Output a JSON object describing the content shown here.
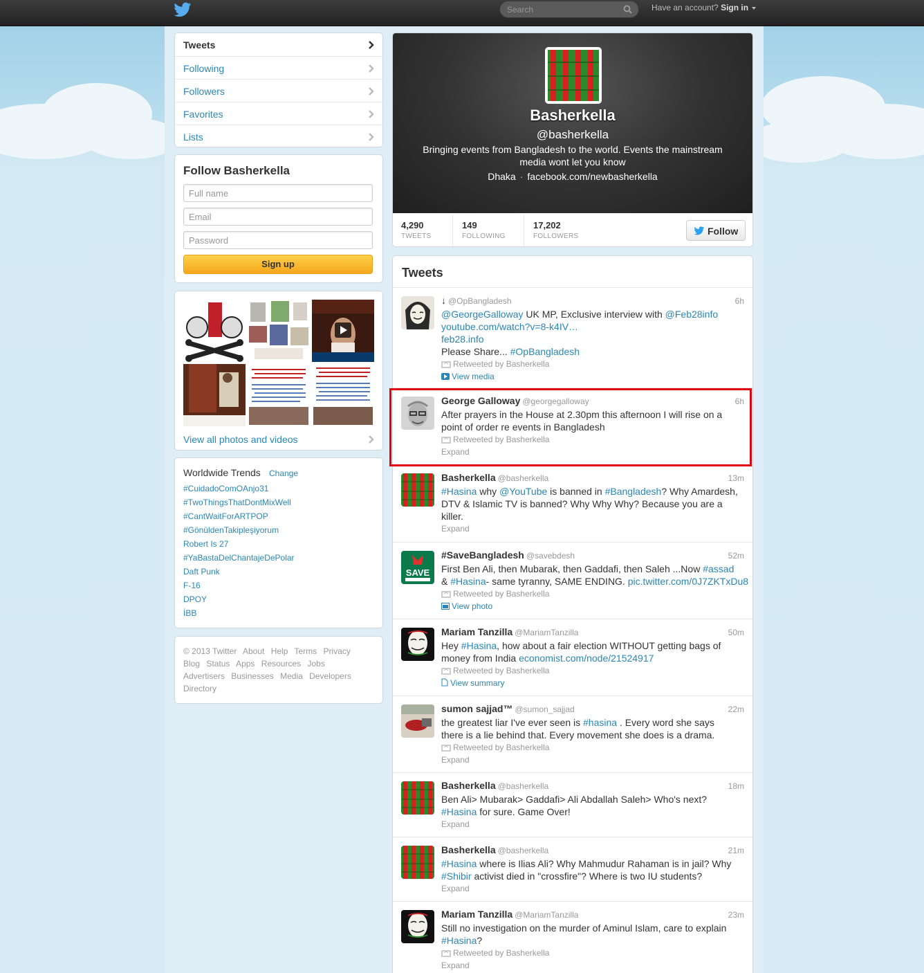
{
  "topbar": {
    "search_placeholder": "Search",
    "have_account": "Have an account?",
    "sign_in": "Sign in"
  },
  "nav": {
    "items": [
      {
        "label": "Tweets"
      },
      {
        "label": "Following"
      },
      {
        "label": "Followers"
      },
      {
        "label": "Favorites"
      },
      {
        "label": "Lists"
      }
    ]
  },
  "signup": {
    "title": "Follow Basherkella",
    "fullname_placeholder": "Full name",
    "email_placeholder": "Email",
    "password_placeholder": "Password",
    "button": "Sign up"
  },
  "media": {
    "link": "View all photos and videos"
  },
  "trends": {
    "title": "Worldwide Trends",
    "change": "Change",
    "items": [
      "#CuidadoComOAnjo31",
      "#TwoThingsThatDontMixWell",
      "#CantWaitForARTPOP",
      "#GönüldenTakipleşiyorum",
      "Robert Is 27",
      "#YaBastaDelChantajeDePolar",
      "Daft Punk",
      "F-16",
      "DPOY",
      "İBB"
    ]
  },
  "footer": {
    "line1": [
      "© 2013 Twitter",
      "About",
      "Help",
      "Terms",
      "Privacy"
    ],
    "line2": [
      "Blog",
      "Status",
      "Apps",
      "Resources",
      "Jobs"
    ],
    "line3": [
      "Advertisers",
      "Businesses",
      "Media",
      "Developers"
    ],
    "line4": [
      "Directory"
    ]
  },
  "profile": {
    "name": "Basherkella",
    "handle": "@basherkella",
    "bio": "Bringing events from Bangladesh to the world. Events the mainstream media wont let you know",
    "location": "Dhaka",
    "url": "facebook.com/newbasherkella",
    "stats": {
      "tweets": "4,290",
      "tweets_label": "TWEETS",
      "following": "149",
      "following_label": "FOLLOWING",
      "followers": "17,202",
      "followers_label": "FOLLOWERS"
    },
    "follow_button": "Follow"
  },
  "tweets": {
    "title": "Tweets",
    "items": [
      {
        "name": "↓",
        "handle": "@OpBangladesh",
        "time": "6h",
        "line1": [
          "@GeorgeGalloway",
          " UK MP, Exclusive interview with ",
          "@Feb28info"
        ],
        "line2": "youtube.com/watch?v=8-k4IV…",
        "line3": "feb28.info",
        "line4": [
          "Please Share... ",
          "#OpBangladesh"
        ],
        "retweeted": "Retweeted by Basherkella",
        "action": "View media"
      },
      {
        "name": "George Galloway",
        "handle": "@georgegalloway",
        "time": "6h",
        "text": "After prayers in the House at 2.30pm this afternoon I will rise on a point of order re events in Bangladesh",
        "retweeted": "Retweeted by Basherkella",
        "action": "Expand"
      },
      {
        "name": "Basherkella",
        "handle": "@basherkella",
        "time": "13m",
        "line1": [
          "#Hasina",
          " why ",
          "@YouTube",
          " is banned in ",
          "#Bangladesh",
          "? Why Amardesh,"
        ],
        "rest": "DTV & Islamic TV is banned? Why Why Why? Because you are a killer.",
        "action": "Expand"
      },
      {
        "name": "#SaveBangladesh",
        "handle": "@savebdesh",
        "time": "52m",
        "line1_a": "First Ben Ali, then Mubarak, then Gaddafi, then Saleh ...Now ",
        "line1_b": "#assad",
        "line2": [
          "& ",
          "#Hasina",
          "- same tyranny, SAME ENDING. ",
          "pic.twitter.com/0J7ZKTxDu8"
        ],
        "retweeted": "Retweeted by Basherkella",
        "action": "View photo"
      },
      {
        "name": "Mariam Tanzilla",
        "handle": "@MariamTanzilla",
        "time": "50m",
        "line1": [
          "Hey ",
          "#Hasina",
          ", how about a fair election WITHOUT getting bags of"
        ],
        "line2": [
          "money from India ",
          "economist.com/node/21524917"
        ],
        "retweeted": "Retweeted by Basherkella",
        "action": "View summary"
      },
      {
        "name": "sumon sajjad™",
        "handle": "@sumon_sajjad",
        "time": "22m",
        "line1": [
          "the greatest liar I've ever seen is ",
          "#hasina",
          " . Every word she says"
        ],
        "line2": "there is a lie behind that. Every movement she does is a drama.",
        "retweeted": "Retweeted by Basherkella",
        "action": "Expand"
      },
      {
        "name": "Basherkella",
        "handle": "@basherkella",
        "time": "18m",
        "line1": "Ben Ali> Mubarak> Gaddafi> Ali Abdallah Saleh> Who's next?",
        "line2": [
          "#Hasina",
          " for sure. Game Over!"
        ],
        "action": "Expand"
      },
      {
        "name": "Basherkella",
        "handle": "@basherkella",
        "time": "21m",
        "line1": [
          "#Hasina",
          " where is Ilias Ali? Why Mahmudur Rahaman is in jail? Why"
        ],
        "line2": [
          "#Shibir",
          " activist died in \"crossfire\"? Where is two IU students?"
        ],
        "action": "Expand"
      },
      {
        "name": "Mariam Tanzilla",
        "handle": "@MariamTanzilla",
        "time": "23m",
        "line1": "Still no investigation on the murder of Aminul Islam, care to explain",
        "line2": [
          "#Hasina",
          "?"
        ],
        "retweeted": "Retweeted by Basherkella",
        "action": "Expand"
      }
    ]
  },
  "colors": {
    "link": "#2a86b6",
    "highlight": "#e3000f",
    "signup_button": "#f5a71c"
  }
}
